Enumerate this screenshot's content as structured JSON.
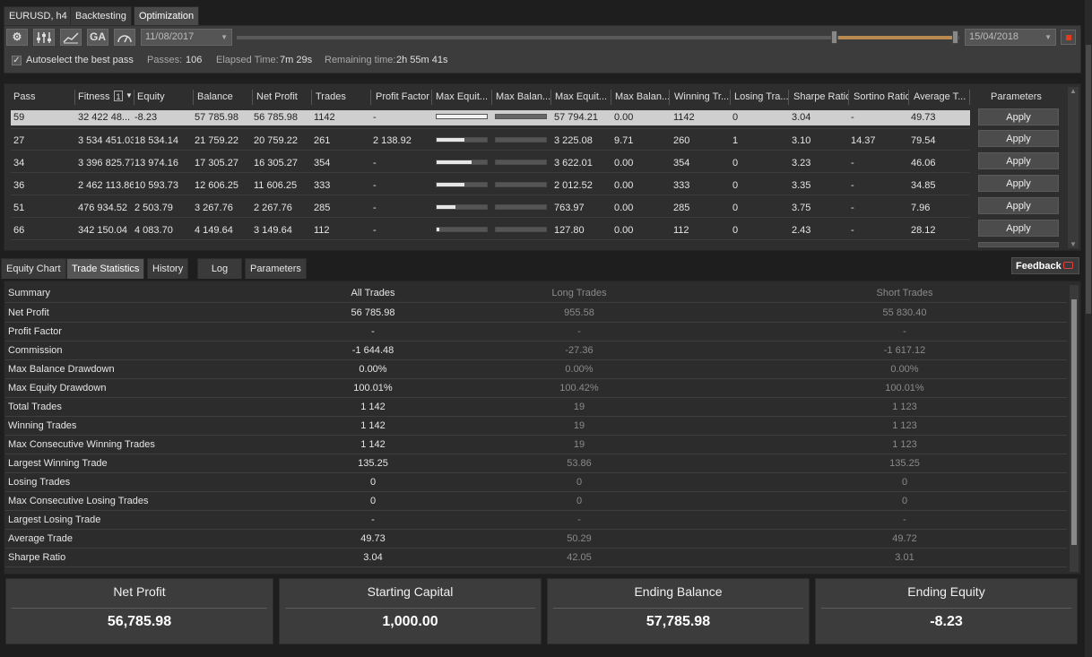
{
  "tabs": [
    {
      "label": "EURUSD, h4",
      "active": false
    },
    {
      "label": "Backtesting",
      "active": false
    },
    {
      "label": "Optimization",
      "active": true
    }
  ],
  "toolbar": {
    "buttons": [
      "gear-icon",
      "sliders-icon",
      "chart-icon",
      "GA",
      "gauge-icon"
    ],
    "ga_label": "GA",
    "start_date": "11/08/2017",
    "end_date": "15/04/2018",
    "autoselect_label": "Autoselect the best pass",
    "autoselect_checked": true,
    "passes_label": "Passes:",
    "passes_value": "106",
    "elapsed_label": "Elapsed Time:",
    "elapsed_value": "7m 29s",
    "remaining_label": "Remaining time:",
    "remaining_value": "2h 55m 41s",
    "accent_color": "#b98a50",
    "stop_color": "#e23a1a"
  },
  "results": {
    "headers": [
      "Pass",
      "Fitness",
      "Equity",
      "Balance",
      "Net Profit",
      "Trades",
      "Profit Factor",
      "Max Equit...",
      "Max Balan...",
      "Max Equit...",
      "Max Balan...",
      "Winning Tr...",
      "Losing Tra...",
      "Sharpe Ratio",
      "Sortino Ratio",
      "Average T...",
      "Parameters"
    ],
    "sort_badge": "1",
    "apply_label": "Apply",
    "rows": [
      {
        "pass": "59",
        "fitness": "32 422 48...",
        "equity": "-8.23",
        "balance": "57 785.98",
        "net_profit": "56 785.98",
        "trades": "1142",
        "profit_factor": "-",
        "max_equity_dd_bar": 1.0,
        "max_balance_dd_bar": 1.0,
        "max_equity": "57 794.21",
        "max_balance": "0.00",
        "winning": "1142",
        "losing": "0",
        "sharpe": "3.04",
        "sortino": "-",
        "average": "49.73",
        "selected": true
      },
      {
        "pass": "27",
        "fitness": "3 534 451.03",
        "equity": "18 534.14",
        "balance": "21 759.22",
        "net_profit": "20 759.22",
        "trades": "261",
        "profit_factor": "2 138.92",
        "max_equity_dd_bar": 0.55,
        "max_balance_dd_bar": 0.0,
        "max_equity": "3 225.08",
        "max_balance": "9.71",
        "winning": "260",
        "losing": "1",
        "sharpe": "3.10",
        "sortino": "14.37",
        "average": "79.54",
        "selected": false
      },
      {
        "pass": "34",
        "fitness": "3 396 825.77",
        "equity": "13 974.16",
        "balance": "17 305.27",
        "net_profit": "16 305.27",
        "trades": "354",
        "profit_factor": "-",
        "max_equity_dd_bar": 0.7,
        "max_balance_dd_bar": 0.0,
        "max_equity": "3 622.01",
        "max_balance": "0.00",
        "winning": "354",
        "losing": "0",
        "sharpe": "3.23",
        "sortino": "-",
        "average": "46.06",
        "selected": false
      },
      {
        "pass": "36",
        "fitness": "2 462 113.86",
        "equity": "10 593.73",
        "balance": "12 606.25",
        "net_profit": "11 606.25",
        "trades": "333",
        "profit_factor": "-",
        "max_equity_dd_bar": 0.55,
        "max_balance_dd_bar": 0.0,
        "max_equity": "2 012.52",
        "max_balance": "0.00",
        "winning": "333",
        "losing": "0",
        "sharpe": "3.35",
        "sortino": "-",
        "average": "34.85",
        "selected": false
      },
      {
        "pass": "51",
        "fitness": "476 934.52",
        "equity": "2 503.79",
        "balance": "3 267.76",
        "net_profit": "2 267.76",
        "trades": "285",
        "profit_factor": "-",
        "max_equity_dd_bar": 0.38,
        "max_balance_dd_bar": 0.0,
        "max_equity": "763.97",
        "max_balance": "0.00",
        "winning": "285",
        "losing": "0",
        "sharpe": "3.75",
        "sortino": "-",
        "average": "7.96",
        "selected": false
      },
      {
        "pass": "66",
        "fitness": "342 150.04",
        "equity": "4 083.70",
        "balance": "4 149.64",
        "net_profit": "3 149.64",
        "trades": "112",
        "profit_factor": "-",
        "max_equity_dd_bar": 0.05,
        "max_balance_dd_bar": 0.0,
        "max_equity": "127.80",
        "max_balance": "0.00",
        "winning": "112",
        "losing": "0",
        "sharpe": "2.43",
        "sortino": "-",
        "average": "28.12",
        "selected": false
      }
    ]
  },
  "bottom_tabs": [
    {
      "label": "Equity Chart",
      "active": false
    },
    {
      "label": "Trade Statistics",
      "active": true
    },
    {
      "label": "History",
      "active": false
    },
    {
      "label": "Log",
      "active": false
    },
    {
      "label": "Parameters",
      "active": false
    }
  ],
  "feedback_label": "Feedback",
  "stats": {
    "headers": [
      "Summary",
      "All Trades",
      "Long Trades",
      "Short Trades"
    ],
    "rows": [
      [
        "Net Profit",
        "56 785.98",
        "955.58",
        "55 830.40"
      ],
      [
        "Profit Factor",
        "-",
        "-",
        "-"
      ],
      [
        "Commission",
        "-1 644.48",
        "-27.36",
        "-1 617.12"
      ],
      [
        "Max Balance Drawdown",
        "0.00%",
        "0.00%",
        "0.00%"
      ],
      [
        "Max Equity Drawdown",
        "100.01%",
        "100.42%",
        "100.01%"
      ],
      [
        "Total Trades",
        "1 142",
        "19",
        "1 123"
      ],
      [
        "Winning Trades",
        "1 142",
        "19",
        "1 123"
      ],
      [
        "Max Consecutive Winning Trades",
        "1 142",
        "19",
        "1 123"
      ],
      [
        "Largest Winning Trade",
        "135.25",
        "53.86",
        "135.25"
      ],
      [
        "Losing Trades",
        "0",
        "0",
        "0"
      ],
      [
        "Max Consecutive Losing Trades",
        "0",
        "0",
        "0"
      ],
      [
        "Largest Losing Trade",
        "-",
        "-",
        "-"
      ],
      [
        "Average Trade",
        "49.73",
        "50.29",
        "49.72"
      ],
      [
        "Sharpe Ratio",
        "3.04",
        "42.05",
        "3.01"
      ]
    ]
  },
  "cards": [
    {
      "title": "Net Profit",
      "value": "56,785.98"
    },
    {
      "title": "Starting Capital",
      "value": "1,000.00"
    },
    {
      "title": "Ending Balance",
      "value": "57,785.98"
    },
    {
      "title": "Ending Equity",
      "value": "-8.23"
    }
  ]
}
